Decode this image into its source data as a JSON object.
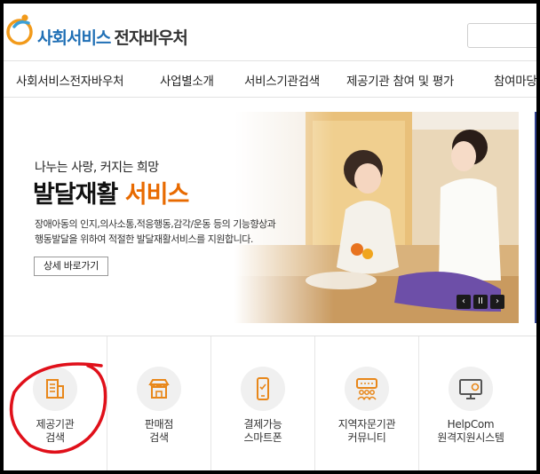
{
  "header": {
    "brand_primary": "사회서비스",
    "brand_secondary": "전자바우처"
  },
  "nav": {
    "items": [
      {
        "label": "사회서비스전자바우처"
      },
      {
        "label": "사업별소개"
      },
      {
        "label": "서비스기관검색"
      },
      {
        "label": "제공기관 참여 및 평가"
      },
      {
        "label": "참여마당"
      }
    ]
  },
  "banner": {
    "tagline": "나누는 사랑, 커지는 희망",
    "headline_main": "발달재활",
    "headline_highlight": "서비스",
    "desc_line1": "장애아동의 인지,의사소통,적응행동,감각/운동 등의 기능향상과",
    "desc_line2": "행동발달을 위하여 적절한 발달재활서비스를 지원합니다.",
    "detail_button": "상세 바로가기",
    "controls": {
      "prev": "‹",
      "pause": "II",
      "next": "›"
    }
  },
  "quick_menu": [
    {
      "line1": "제공기관",
      "line2": "검색",
      "icon": "building-icon"
    },
    {
      "line1": "판매점",
      "line2": "검색",
      "icon": "store-icon"
    },
    {
      "line1": "결제가능",
      "line2": "스마트폰",
      "icon": "smartphone-icon"
    },
    {
      "line1": "지역자문기관",
      "line2": "커뮤니티",
      "icon": "community-icon"
    },
    {
      "line1": "HelpCom",
      "line2": "원격지원시스템",
      "icon": "monitor-icon"
    }
  ],
  "colors": {
    "brand_blue": "#1f6fb5",
    "highlight_orange": "#e86a00",
    "annotation_red": "#e0101a",
    "icon_orange": "#e8871a"
  }
}
